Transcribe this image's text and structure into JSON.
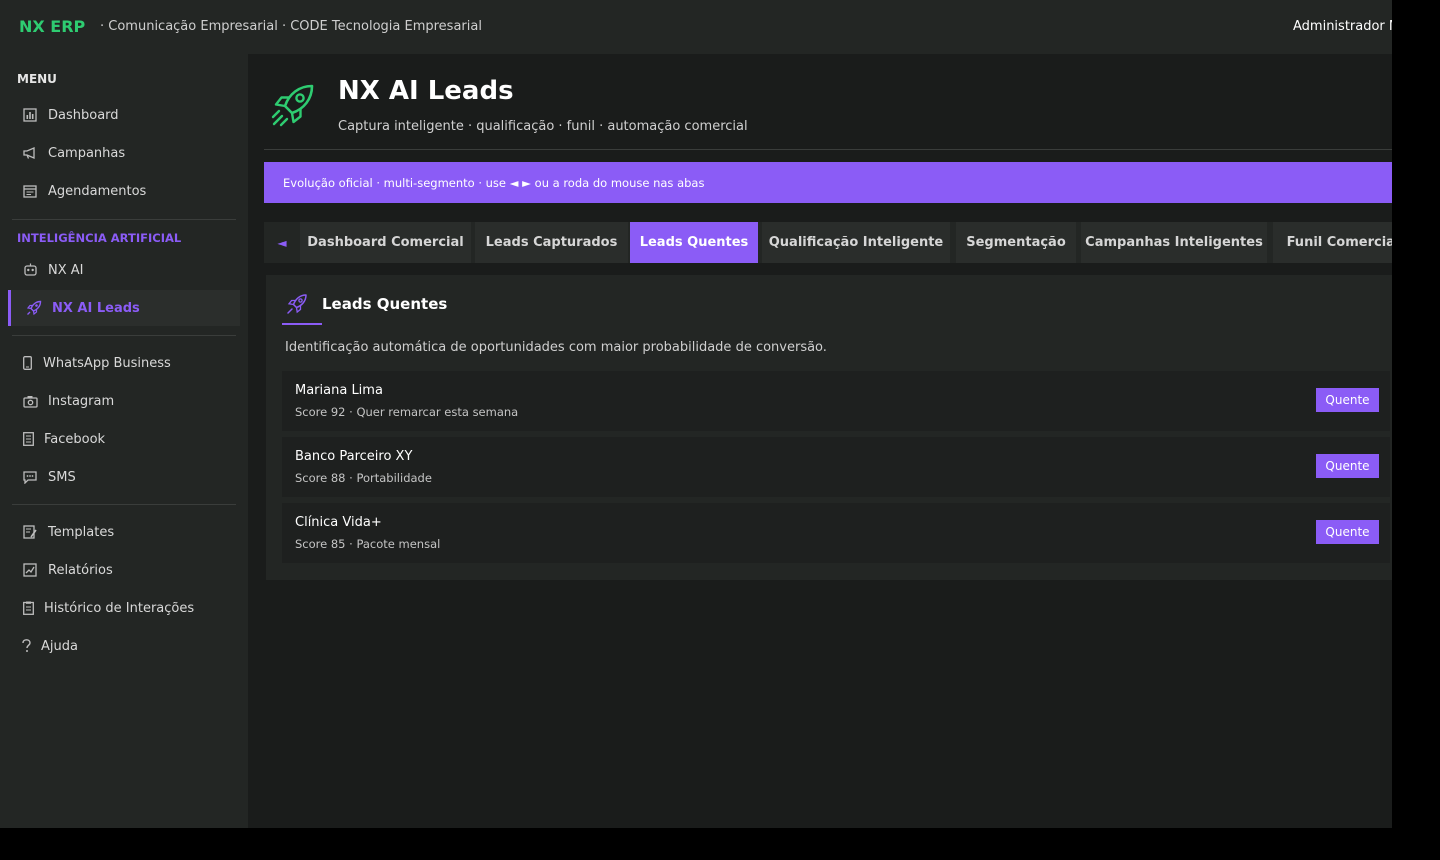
{
  "app": {
    "brand": "NX ERP",
    "subtitle": "· Comunicação Empresarial · CODE Tecnologia Empresarial",
    "user": "Administrador M"
  },
  "sidebar": {
    "menu_title": "MENU",
    "ai_title": "INTELIGÊNCIA ARTIFICIAL",
    "items": [
      {
        "label": "Dashboard",
        "icon": "bar-chart-icon"
      },
      {
        "label": "Campanhas",
        "icon": "megaphone-icon"
      },
      {
        "label": "Agendamentos",
        "icon": "calendar-icon"
      },
      {
        "label": "NX AI",
        "icon": "robot-icon"
      },
      {
        "label": "NX AI Leads",
        "icon": "rocket-icon"
      },
      {
        "label": "WhatsApp Business",
        "icon": "phone-icon"
      },
      {
        "label": "Instagram",
        "icon": "camera-icon"
      },
      {
        "label": "Facebook",
        "icon": "book-icon"
      },
      {
        "label": "SMS",
        "icon": "chat-icon"
      },
      {
        "label": "Templates",
        "icon": "document-edit-icon"
      },
      {
        "label": "Relatórios",
        "icon": "chart-line-icon"
      },
      {
        "label": "Histórico de Interações",
        "icon": "clipboard-icon"
      },
      {
        "label": "Ajuda",
        "icon": "question-icon"
      }
    ]
  },
  "header": {
    "title": "NX AI Leads",
    "subtitle": "Captura inteligente · qualificação · funil · automação comercial"
  },
  "banner": {
    "text": "Evolução oficial · multi-segmento · use ◄ ► ou a roda do mouse nas abas"
  },
  "tabs": {
    "prev_arrow": "◄",
    "items": [
      {
        "label": "Dashboard Comercial"
      },
      {
        "label": "Leads Capturados"
      },
      {
        "label": "Leads Quentes"
      },
      {
        "label": "Qualificação Inteligente"
      },
      {
        "label": "Segmentação"
      },
      {
        "label": "Campanhas Inteligentes"
      },
      {
        "label": "Funil Comercial"
      }
    ],
    "active": "Leads Quentes"
  },
  "panel": {
    "title": "Leads Quentes",
    "description": "Identificação automática de oportunidades com maior probabilidade de conversão.",
    "leads": [
      {
        "name": "Mariana Lima",
        "meta": "Score 92 · Quer remarcar esta semana",
        "badge": "Quente"
      },
      {
        "name": "Banco Parceiro XY",
        "meta": "Score 88 · Portabilidade",
        "badge": "Quente"
      },
      {
        "name": "Clínica Vida+",
        "meta": "Score 85 · Pacote mensal",
        "badge": "Quente"
      }
    ]
  },
  "colors": {
    "accent": "#8b5cf6",
    "brand": "#2ecc71",
    "background": "#1a1c1b",
    "surface": "#232624"
  }
}
